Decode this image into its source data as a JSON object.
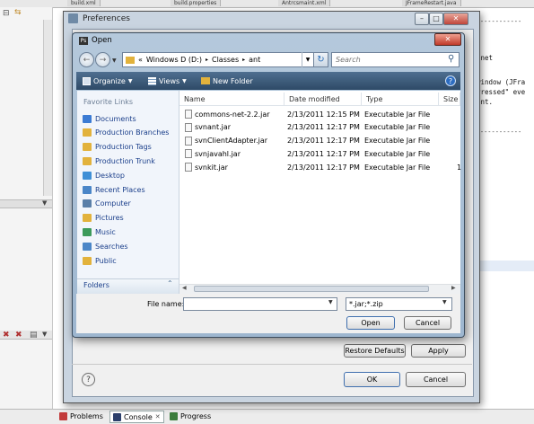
{
  "ide": {
    "tabs": [
      "build.xml",
      "build.properties",
      "Antrcsmaint.xml",
      "JFrameRestart.java"
    ],
    "code_lines": [
      ".net",
      "window (JFra",
      "Pressed\" eve",
      "ent."
    ],
    "bottom_tabs": [
      {
        "label": "Problems"
      },
      {
        "label": "Console"
      },
      {
        "label": "Progress"
      }
    ]
  },
  "preferences": {
    "title": "Preferences",
    "restore_defaults_label": "Restore Defaults",
    "apply_label": "Apply",
    "ok_label": "OK",
    "cancel_label": "Cancel",
    "help_glyph": "?"
  },
  "open_dialog": {
    "title": "Open",
    "path": {
      "prefix": "«",
      "segments": [
        "Windows D (D:)",
        "Classes",
        "ant"
      ]
    },
    "search_placeholder": "Search",
    "toolbar": {
      "organize_label": "Organize",
      "views_label": "Views",
      "new_folder_label": "New Folder"
    },
    "favorite_links_title": "Favorite Links",
    "favorite_links": [
      {
        "label": "Documents",
        "icon": "documents-icon",
        "color": "#3b7bd4"
      },
      {
        "label": "Production Branches",
        "icon": "folder-icon",
        "color": "#e2b23c"
      },
      {
        "label": "Production Tags",
        "icon": "folder-icon",
        "color": "#e2b23c"
      },
      {
        "label": "Production Trunk",
        "icon": "folder-icon",
        "color": "#e2b23c"
      },
      {
        "label": "Desktop",
        "icon": "desktop-icon",
        "color": "#3f8fd6"
      },
      {
        "label": "Recent Places",
        "icon": "recent-places-icon",
        "color": "#4a86c8"
      },
      {
        "label": "Computer",
        "icon": "computer-icon",
        "color": "#5a7fa8"
      },
      {
        "label": "Pictures",
        "icon": "folder-icon",
        "color": "#e2b23c"
      },
      {
        "label": "Music",
        "icon": "music-icon",
        "color": "#3c9a5a"
      },
      {
        "label": "Searches",
        "icon": "search-folder-icon",
        "color": "#4a86c8"
      },
      {
        "label": "Public",
        "icon": "folder-icon",
        "color": "#e2b23c"
      }
    ],
    "folders_label": "Folders",
    "columns": {
      "name": "Name",
      "date_modified": "Date modified",
      "type": "Type",
      "size": "Size"
    },
    "files": [
      {
        "name": "commons-net-2.2.jar",
        "date": "2/13/2011 12:15 PM",
        "type": "Executable Jar File",
        "size": ""
      },
      {
        "name": "svnant.jar",
        "date": "2/13/2011 12:17 PM",
        "type": "Executable Jar File",
        "size": ""
      },
      {
        "name": "svnClientAdapter.jar",
        "date": "2/13/2011 12:17 PM",
        "type": "Executable Jar File",
        "size": ""
      },
      {
        "name": "svnjavahl.jar",
        "date": "2/13/2011 12:17 PM",
        "type": "Executable Jar File",
        "size": ""
      },
      {
        "name": "svnkit.jar",
        "date": "2/13/2011 12:17 PM",
        "type": "Executable Jar File",
        "size": "1"
      }
    ],
    "file_name_label": "File name:",
    "file_name_value": "",
    "file_type_value": "*.jar;*.zip",
    "open_label": "Open",
    "cancel_label": "Cancel"
  }
}
